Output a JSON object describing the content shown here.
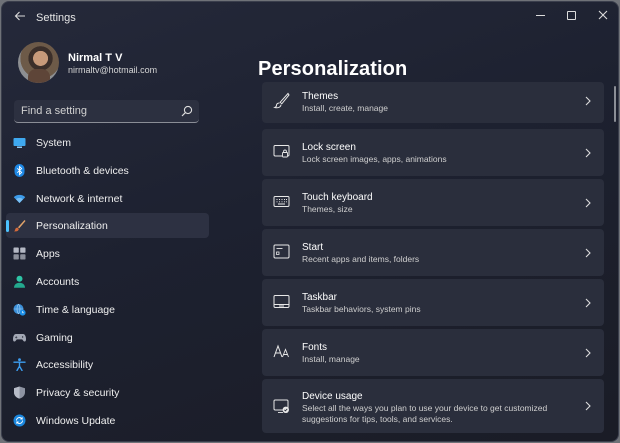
{
  "app": {
    "title": "Settings"
  },
  "profile": {
    "name": "Nirmal T V",
    "email": "nirmaltv@hotmail.com"
  },
  "search": {
    "placeholder": "Find a setting"
  },
  "sidebar": {
    "items": [
      {
        "label": "System",
        "icon": "system-icon",
        "active": false
      },
      {
        "label": "Bluetooth & devices",
        "icon": "bluetooth-icon",
        "active": false
      },
      {
        "label": "Network & internet",
        "icon": "wifi-icon",
        "active": false
      },
      {
        "label": "Personalization",
        "icon": "brush-icon",
        "active": true
      },
      {
        "label": "Apps",
        "icon": "apps-icon",
        "active": false
      },
      {
        "label": "Accounts",
        "icon": "person-icon",
        "active": false
      },
      {
        "label": "Time & language",
        "icon": "globe-clock-icon",
        "active": false
      },
      {
        "label": "Gaming",
        "icon": "gamepad-icon",
        "active": false
      },
      {
        "label": "Accessibility",
        "icon": "accessibility-icon",
        "active": false
      },
      {
        "label": "Privacy & security",
        "icon": "shield-icon",
        "active": false
      },
      {
        "label": "Windows Update",
        "icon": "update-icon",
        "active": false
      }
    ]
  },
  "main": {
    "title": "Personalization",
    "cards": [
      {
        "title": "Themes",
        "subtitle": "Install, create, manage",
        "icon": "brush-icon"
      },
      {
        "title": "Lock screen",
        "subtitle": "Lock screen images, apps, animations",
        "icon": "lock-screen-icon"
      },
      {
        "title": "Touch keyboard",
        "subtitle": "Themes, size",
        "icon": "keyboard-icon"
      },
      {
        "title": "Start",
        "subtitle": "Recent apps and items, folders",
        "icon": "start-icon"
      },
      {
        "title": "Taskbar",
        "subtitle": "Taskbar behaviors, system pins",
        "icon": "taskbar-icon"
      },
      {
        "title": "Fonts",
        "subtitle": "Install, manage",
        "icon": "fonts-icon"
      },
      {
        "title": "Device usage",
        "subtitle": "Select all the ways you plan to use your device to get customized suggestions for tips, tools, and services.",
        "icon": "device-usage-icon"
      }
    ]
  },
  "colors": {
    "accent": "#4cc2ff",
    "window_bg": "#1d2130",
    "card_bg": "#2a2e3c"
  }
}
